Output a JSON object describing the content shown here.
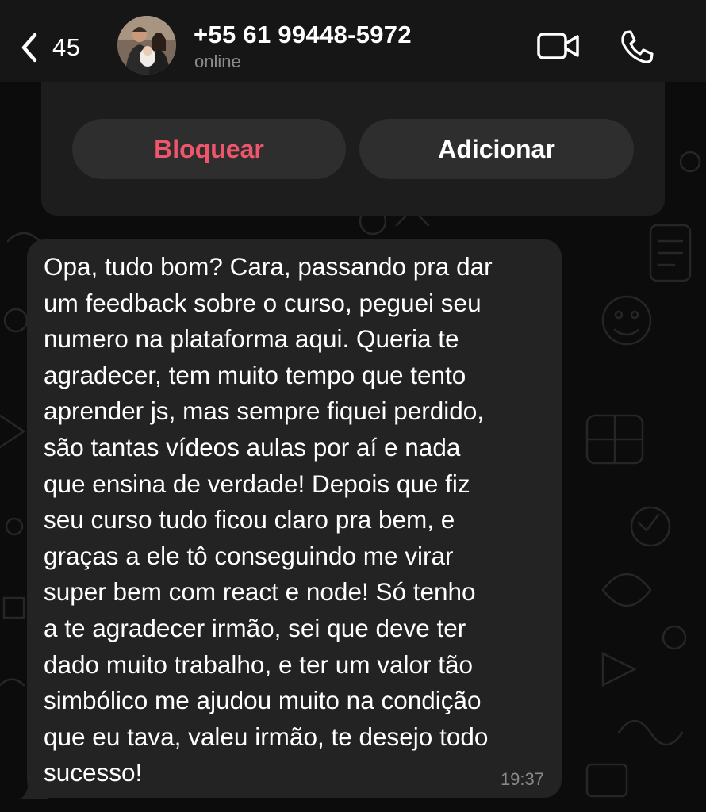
{
  "header": {
    "back_count": "45",
    "contact_name": "+55 61 99448-5972",
    "status": "online",
    "icons": {
      "back": "chevron-left-icon",
      "video": "video-camera-icon",
      "phone": "phone-icon"
    }
  },
  "contact_card": {
    "block_label": "Bloquear",
    "add_label": "Adicionar"
  },
  "message": {
    "text": "Opa, tudo bom? Cara, passando pra dar\num feedback sobre o curso, peguei seu\nnumero na plataforma aqui. Queria te\nagradecer, tem muito tempo que tento\naprender js, mas sempre fiquei perdido,\nsão tantas vídeos aulas por aí e nada\nque ensina de verdade! Depois que fiz\nseu curso tudo ficou claro pra bem, e\ngraças a ele tô conseguindo me virar\nsuper bem com react e node! Só tenho\na te agradecer irmão, sei que deve ter\ndado muito trabalho, e ter um valor tão\nsimbólico me ajudou muito na condição\nque eu tava, valeu irmão, te desejo todo\nsucesso!",
    "time": "19:37"
  },
  "colors": {
    "header_bg": "#161616",
    "bubble_bg": "#232323",
    "block_red": "#f0566b",
    "muted_text": "#8b8b8b"
  }
}
